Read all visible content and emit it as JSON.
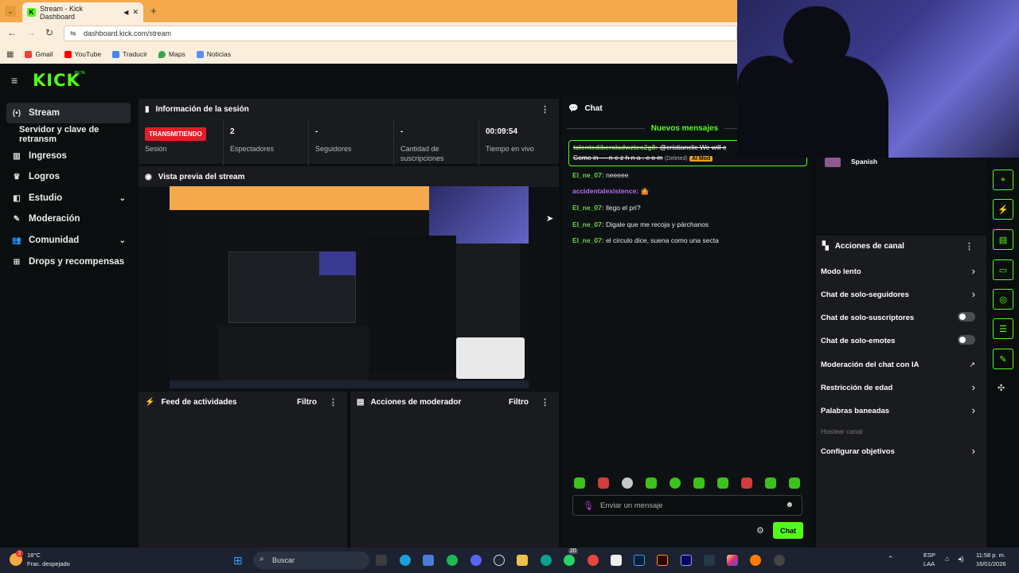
{
  "browser": {
    "tab_title": "Stream - Kick Dashboard",
    "url": "dashboard.kick.com/stream",
    "bookmarks": [
      "Gmail",
      "YouTube",
      "Traducir",
      "Maps",
      "Noticias"
    ]
  },
  "kick": {
    "logo": "KICK",
    "beta": "BETA"
  },
  "sidebar": {
    "items": [
      {
        "label": "Stream",
        "icon": "broadcast-icon"
      },
      {
        "label": "Servidor y clave de retransm",
        "icon": ""
      },
      {
        "label": "Ingresos",
        "icon": "bank-icon"
      },
      {
        "label": "Logros",
        "icon": "trophy-icon"
      },
      {
        "label": "Estudio",
        "icon": "studio-icon"
      },
      {
        "label": "Moderación",
        "icon": "wrench-icon"
      },
      {
        "label": "Comunidad",
        "icon": "people-icon"
      },
      {
        "label": "Drops y recompensas",
        "icon": "gift-icon"
      }
    ]
  },
  "session": {
    "title": "Información de la sesión",
    "live_badge": "TRANSMITIENDO",
    "session_label": "Sesión",
    "stats": [
      {
        "value": "2",
        "label": "Espectadores"
      },
      {
        "value": "-",
        "label": "Seguidores"
      },
      {
        "value": "-",
        "label": "Cantidad de suscripciones"
      },
      {
        "value": "00:09:54",
        "label": "Tiempo en vivo"
      }
    ]
  },
  "preview": {
    "title": "Vista previa del stream"
  },
  "activity": {
    "title": "Feed de actividades",
    "filter": "Filtro"
  },
  "modactions": {
    "title": "Acciones de moderador",
    "filter": "Filtro"
  },
  "chat": {
    "title": "Chat",
    "banner": "Nuevos mensajes",
    "highlight": {
      "user": "talentediberaladwztco2g8:",
      "line1": "@cristianclic We will c",
      "line2": "Come in --- n e z h n a . c o m",
      "deleted": "(Deleted)",
      "badge": "AI Mod"
    },
    "messages": [
      {
        "user": "El_ne_07:",
        "text": "neeeee",
        "color": "green"
      },
      {
        "user": "accidentalexistence:",
        "text": "",
        "color": "purple"
      },
      {
        "user": "El_ne_07:",
        "text": "llego el pri?",
        "color": "green"
      },
      {
        "user": "El_ne_07:",
        "text": "Digale que me recoja y párchanos",
        "color": "green"
      },
      {
        "user": "El_ne_07:",
        "text": "el circulo dice, suena como una secta",
        "color": "green"
      }
    ],
    "placeholder": "Enviar un mensaje",
    "send": "Chat"
  },
  "language": "Spanish",
  "channel_actions": {
    "title": "Acciones de canal",
    "rows": [
      {
        "label": "Modo lento",
        "kind": "chevron"
      },
      {
        "label": "Chat de solo-seguidores",
        "kind": "chevron"
      },
      {
        "label": "Chat de solo-suscriptores",
        "kind": "toggle"
      },
      {
        "label": "Chat de solo-emotes",
        "kind": "toggle"
      },
      {
        "label": "Moderación del chat con IA",
        "kind": "external"
      },
      {
        "label": "Restricción de edad",
        "kind": "chevron"
      },
      {
        "label": "Palabras baneadas",
        "kind": "chevron"
      },
      {
        "label": "Hostear canal",
        "kind": "disabled"
      },
      {
        "label": "Configurar objetivos",
        "kind": "chevron"
      }
    ]
  },
  "taskbar": {
    "weather_temp": "18°C",
    "weather_desc": "Frac. despejado",
    "search": "Buscar",
    "badge_count": "20",
    "lang1": "ESP",
    "lang2": "LAA",
    "time": "11:58 p. m.",
    "date": "16/01/2026",
    "weather_badge": "2"
  },
  "colors": {
    "accent": "#53fc18",
    "live": "#e51c29",
    "panel": "#191b1f",
    "bg": "#0b0e0f"
  }
}
